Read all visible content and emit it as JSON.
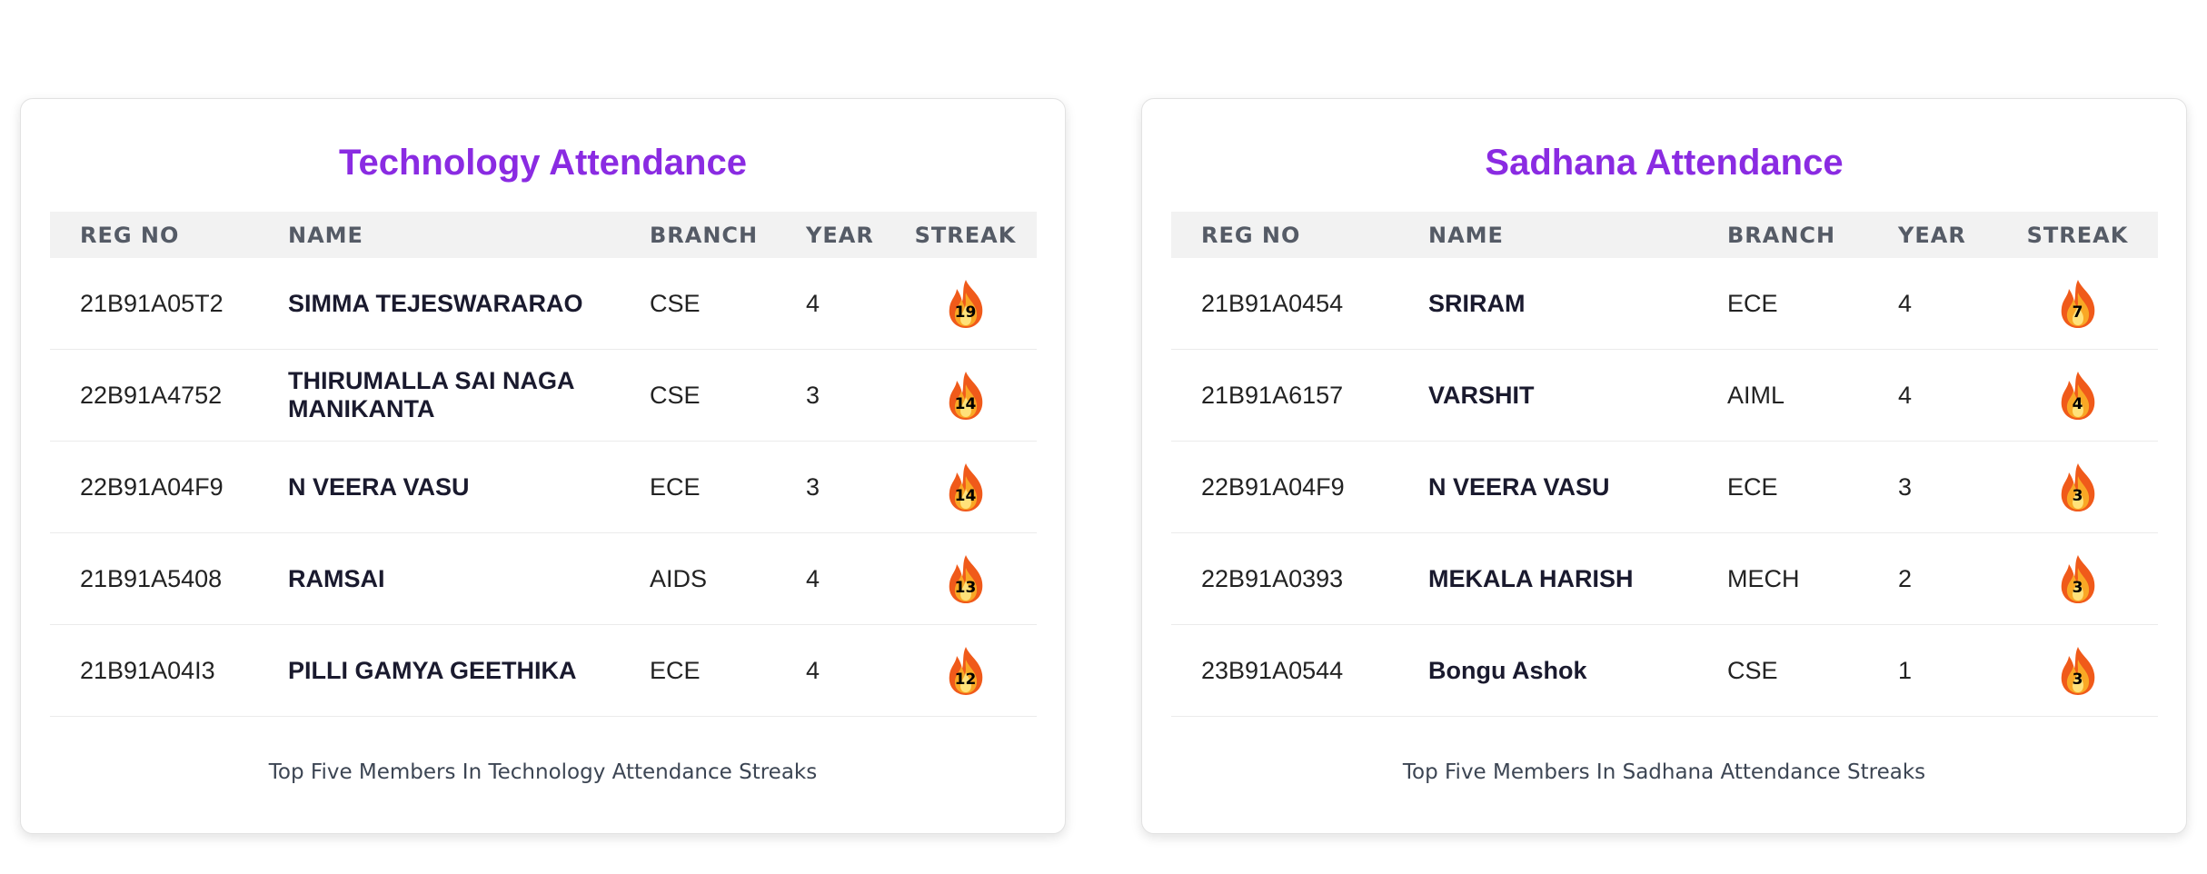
{
  "tech": {
    "title": "Technology Attendance",
    "headers": {
      "reg": "REG NO",
      "name": "NAME",
      "branch": "BRANCH",
      "year": "YEAR",
      "streak": "STREAK"
    },
    "rows": [
      {
        "reg": "21B91A05T2",
        "name": "SIMMA TEJESWARARAO",
        "branch": "CSE",
        "year": "4",
        "streak": "19"
      },
      {
        "reg": "22B91A4752",
        "name": "THIRUMALLA SAI NAGA MANIKANTA",
        "branch": "CSE",
        "year": "3",
        "streak": "14"
      },
      {
        "reg": "22B91A04F9",
        "name": "N VEERA VASU",
        "branch": "ECE",
        "year": "3",
        "streak": "14"
      },
      {
        "reg": "21B91A5408",
        "name": "RAMSAI",
        "branch": "AIDS",
        "year": "4",
        "streak": "13"
      },
      {
        "reg": "21B91A04I3",
        "name": "PILLI GAMYA GEETHIKA",
        "branch": "ECE",
        "year": "4",
        "streak": "12"
      }
    ],
    "caption": "Top Five Members In Technology Attendance Streaks"
  },
  "sadhana": {
    "title": "Sadhana Attendance",
    "headers": {
      "reg": "REG NO",
      "name": "NAME",
      "branch": "BRANCH",
      "year": "YEAR",
      "streak": "STREAK"
    },
    "rows": [
      {
        "reg": "21B91A0454",
        "name": "SRIRAM",
        "branch": "ECE",
        "year": "4",
        "streak": "7"
      },
      {
        "reg": "21B91A6157",
        "name": "VARSHIT",
        "branch": "AIML",
        "year": "4",
        "streak": "4"
      },
      {
        "reg": "22B91A04F9",
        "name": "N VEERA VASU",
        "branch": "ECE",
        "year": "3",
        "streak": "3"
      },
      {
        "reg": "22B91A0393",
        "name": "MEKALA HARISH",
        "branch": "MECH",
        "year": "2",
        "streak": "3"
      },
      {
        "reg": "23B91A0544",
        "name": "Bongu Ashok",
        "branch": "CSE",
        "year": "1",
        "streak": "3"
      }
    ],
    "caption": "Top Five Members In Sadhana Attendance Streaks"
  },
  "icons": {
    "streak": "fire-icon"
  },
  "colors": {
    "title": "#8a2be2",
    "header_bg": "#f2f2f2"
  }
}
